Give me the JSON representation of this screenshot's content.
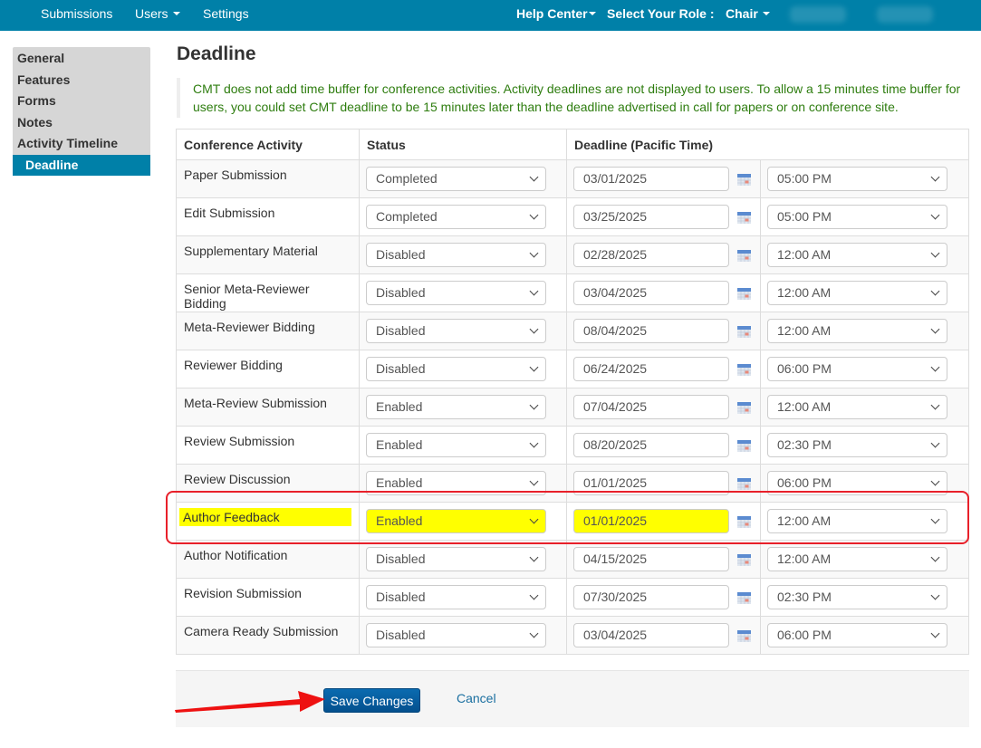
{
  "topnav": {
    "left_items": [
      {
        "label": "Submissions",
        "has_caret": false
      },
      {
        "label": "Users",
        "has_caret": true
      },
      {
        "label": "Settings",
        "has_caret": false
      }
    ],
    "help_center": "Help Center",
    "role_label": "Select Your Role :",
    "role_value": "Chair",
    "color": "#0080a8"
  },
  "sidebar": {
    "items": [
      {
        "label": "General",
        "active": false
      },
      {
        "label": "Features",
        "active": false
      },
      {
        "label": "Forms",
        "active": false
      },
      {
        "label": "Notes",
        "active": false
      },
      {
        "label": "Activity Timeline",
        "active": false
      },
      {
        "label": "Deadline",
        "active": true
      }
    ]
  },
  "page": {
    "title": "Deadline",
    "note": "CMT does not add time buffer for conference activities. Activity deadlines are not displayed to users. To allow a 15 minutes time buffer for users, you could set CMT deadline to be 15 minutes later than the deadline advertised in call for papers or on conference site."
  },
  "table": {
    "headers": [
      "Conference Activity",
      "Status",
      "Deadline (Pacific Time)"
    ],
    "rows": [
      {
        "activity": "Paper Submission",
        "status": "Completed",
        "date": "03/01/2025",
        "time": "05:00 PM",
        "highlighted": false
      },
      {
        "activity": "Edit Submission",
        "status": "Completed",
        "date": "03/25/2025",
        "time": "05:00 PM",
        "highlighted": false
      },
      {
        "activity": "Supplementary Material",
        "status": "Disabled",
        "date": "02/28/2025",
        "time": "12:00 AM",
        "highlighted": false
      },
      {
        "activity": "Senior Meta-Reviewer Bidding",
        "status": "Disabled",
        "date": "03/04/2025",
        "time": "12:00 AM",
        "highlighted": false
      },
      {
        "activity": "Meta-Reviewer Bidding",
        "status": "Disabled",
        "date": "08/04/2025",
        "time": "12:00 AM",
        "highlighted": false
      },
      {
        "activity": "Reviewer Bidding",
        "status": "Disabled",
        "date": "06/24/2025",
        "time": "06:00 PM",
        "highlighted": false
      },
      {
        "activity": "Meta-Review Submission",
        "status": "Enabled",
        "date": "07/04/2025",
        "time": "12:00 AM",
        "highlighted": false
      },
      {
        "activity": "Review Submission",
        "status": "Enabled",
        "date": "08/20/2025",
        "time": "02:30 PM",
        "highlighted": false
      },
      {
        "activity": "Review Discussion",
        "status": "Enabled",
        "date": "01/01/2025",
        "time": "06:00 PM",
        "highlighted": false
      },
      {
        "activity": "Author Feedback",
        "status": "Enabled",
        "date": "01/01/2025",
        "time": "12:00 AM",
        "highlighted": true
      },
      {
        "activity": "Author Notification",
        "status": "Disabled",
        "date": "04/15/2025",
        "time": "12:00 AM",
        "highlighted": false
      },
      {
        "activity": "Revision Submission",
        "status": "Disabled",
        "date": "07/30/2025",
        "time": "02:30 PM",
        "highlighted": false
      },
      {
        "activity": "Camera Ready Submission",
        "status": "Disabled",
        "date": "03/04/2025",
        "time": "06:00 PM",
        "highlighted": false
      }
    ]
  },
  "actions": {
    "save_label": "Save Changes",
    "cancel_label": "Cancel"
  },
  "annotations": {
    "highlight_color": "#ffff00",
    "box_color": "#e8202a",
    "arrow_color": "#ee1111",
    "arrow_target": "Save Changes"
  }
}
